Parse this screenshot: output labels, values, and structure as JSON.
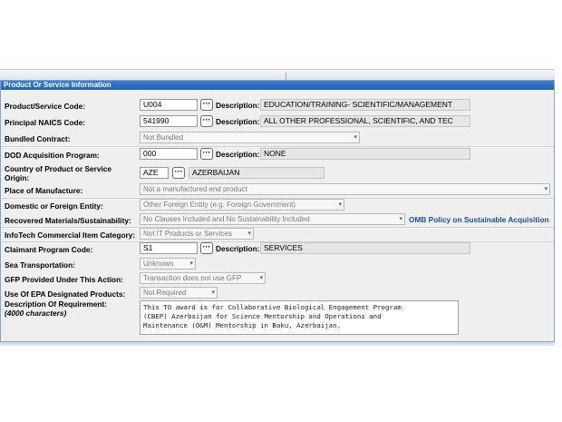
{
  "panel": {
    "title": "Product Or Service Information"
  },
  "fields": {
    "product_service_code": {
      "label": "Product/Service Code:",
      "value": "U004",
      "desc_label": "Description:",
      "desc": "EDUCATION/TRAINING- SCIENTIFIC/MANAGEMENT"
    },
    "naics_code": {
      "label": "Principal NAICS Code:",
      "value": "541990",
      "desc_label": "Description:",
      "desc": "ALL OTHER PROFESSIONAL, SCIENTIFIC, AND TEC"
    },
    "bundled_contract": {
      "label": "Bundled Contract:",
      "value": "Not Bundled"
    },
    "dod_program": {
      "label": "DOD Acquisition Program:",
      "value": "000",
      "desc_label": "Description:",
      "desc": "NONE"
    },
    "country_origin": {
      "label_line1": "Country of Product or Service",
      "label_line2": "Origin:",
      "value": "AZE",
      "desc": "AZERBAIJAN"
    },
    "place_manufacture": {
      "label": "Place of Manufacture:",
      "value": "Not a manufactured end product"
    },
    "domestic_foreign": {
      "label": "Domestic or Foreign Entity:",
      "value": "Other Foreign Entity (e.g. Foreign Government)"
    },
    "recovered_materials": {
      "label": "Recovered Materials/Sustainability:",
      "value": "No Clauses Included and No Sustainability Included",
      "link": "OMB Policy on Sustainable Acquisition"
    },
    "infotech": {
      "label": "InfoTech Commercial Item Category:",
      "value": "Not IT Products or Services"
    },
    "claimant_program": {
      "label": "Claimant Program Code:",
      "value": "S1",
      "desc_label": "Description:",
      "desc": "SERVICES"
    },
    "sea_transport": {
      "label": "Sea Transportation:",
      "value": "Unknown"
    },
    "gfp": {
      "label": "GFP Provided Under This Action:",
      "value": "Transaction does not use GFP"
    },
    "epa_products": {
      "label": "Use Of EPA Designated Products:",
      "value": "Not Required"
    },
    "description_req": {
      "label": "Description Of Requirement:",
      "sublabel": "(4000 characters)",
      "value": "This TO award is for Collaborative Biological Engagement Program\n(CBEP) Azerbaijan for Science Mentorship and Operations and\nMaintenance (O&M) Mentorship in Baku, Azerbaijan."
    }
  },
  "icons": {
    "lookup": "ellipsis-icon",
    "dropdown": "chevron-down-icon"
  },
  "colors": {
    "header": "#2f6fc4",
    "link": "#1d4f9b",
    "panel_bg": "#efefef"
  }
}
